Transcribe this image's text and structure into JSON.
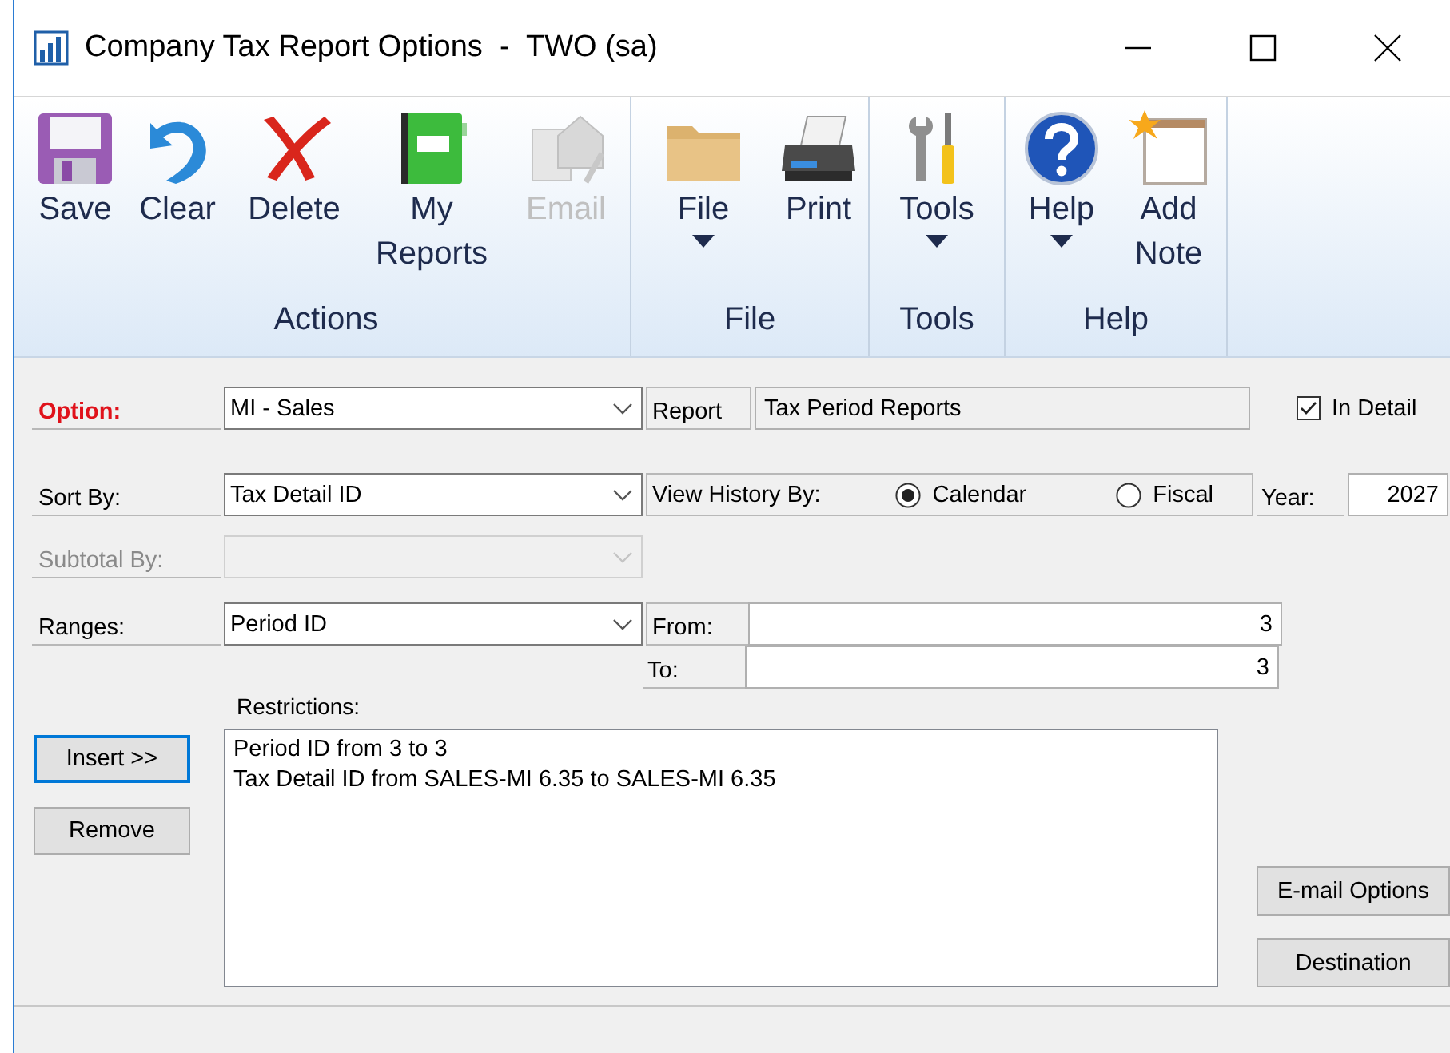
{
  "window": {
    "title": "Company Tax Report Options  -  TWO (sa)"
  },
  "ribbon": {
    "groups": [
      {
        "label": "Actions",
        "buttons": [
          {
            "label": "Save",
            "disabled": false,
            "dropdown": false
          },
          {
            "label": "Clear",
            "disabled": false,
            "dropdown": false
          },
          {
            "label": "Delete",
            "disabled": false,
            "dropdown": false
          },
          {
            "label": "My Reports",
            "disabled": false,
            "dropdown": false
          },
          {
            "label": "Email",
            "disabled": true,
            "dropdown": false
          }
        ]
      },
      {
        "label": "File",
        "buttons": [
          {
            "label": "File",
            "disabled": false,
            "dropdown": true
          },
          {
            "label": "Print",
            "disabled": false,
            "dropdown": false
          }
        ]
      },
      {
        "label": "Tools",
        "buttons": [
          {
            "label": "Tools",
            "disabled": false,
            "dropdown": true
          }
        ]
      },
      {
        "label": "Help",
        "buttons": [
          {
            "label": "Help",
            "disabled": false,
            "dropdown": true
          },
          {
            "label": "Add Note",
            "disabled": false,
            "dropdown": false
          }
        ]
      }
    ]
  },
  "option": {
    "label": "Option:",
    "value": "MI - Sales"
  },
  "report": {
    "label": "Report",
    "value": "Tax Period Reports"
  },
  "in_detail": {
    "label": "In Detail",
    "checked": true
  },
  "sort_by": {
    "label": "Sort By:",
    "value": "Tax Detail ID"
  },
  "view_history": {
    "label": "View History By:",
    "options": [
      {
        "label": "Calendar",
        "selected": true
      },
      {
        "label": "Fiscal",
        "selected": false
      }
    ]
  },
  "year": {
    "label": "Year:",
    "value": "2027"
  },
  "subtotal_by": {
    "label": "Subtotal By:",
    "disabled": true
  },
  "ranges": {
    "label": "Ranges:",
    "value": "Period ID"
  },
  "from": {
    "label": "From:",
    "value": "3"
  },
  "to": {
    "label": "To:",
    "value": "3"
  },
  "restrictions": {
    "label": "Restrictions:",
    "items": [
      "Period ID from 3 to 3",
      "Tax Detail ID from SALES-MI 6.35 to SALES-MI 6.35"
    ]
  },
  "buttons": [
    {
      "label": "Insert >>",
      "focused": true
    },
    {
      "label": "Remove",
      "focused": false
    }
  ],
  "output_buttons": [
    {
      "label": "E-mail Options"
    },
    {
      "label": "Destination"
    }
  ]
}
